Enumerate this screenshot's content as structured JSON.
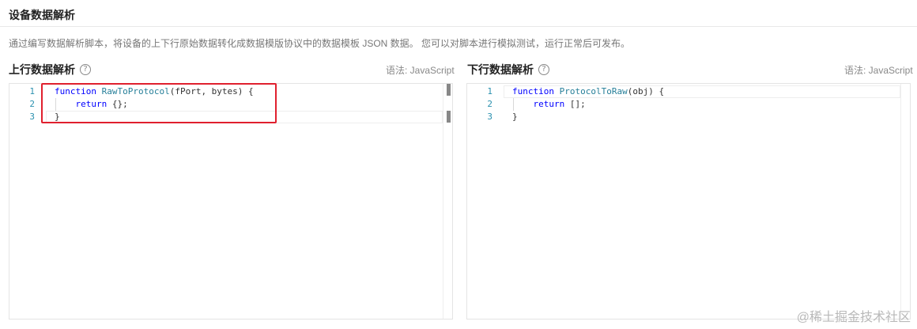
{
  "section": {
    "title": "设备数据解析",
    "description": "通过编写数据解析脚本，将设备的上下行原始数据转化成数据模版协议中的数据模板 JSON 数据。 您可以对脚本进行模拟测试，运行正常后可发布。"
  },
  "uplink": {
    "title": "上行数据解析",
    "help_icon": "?",
    "syntax": "语法: JavaScript",
    "line_numbers": [
      "1",
      "2",
      "3"
    ],
    "code": {
      "line1_kw": "function",
      "line1_fn": "RawToProtocol",
      "line1_rest": "(fPort, bytes) {",
      "line2_kw": "return",
      "line2_rest": " {};",
      "line3": "}"
    }
  },
  "downlink": {
    "title": "下行数据解析",
    "help_icon": "?",
    "syntax": "语法: JavaScript",
    "line_numbers": [
      "1",
      "2",
      "3"
    ],
    "code": {
      "line1_kw": "function",
      "line1_fn": "ProtocolToRaw",
      "line1_rest": "(obj) {",
      "line2_kw": "return",
      "line2_rest": " [];",
      "line3": "}"
    }
  },
  "watermark": "@稀土掘金技术社区",
  "colors": {
    "highlight_border": "#e0202e",
    "keyword": "#0000ff",
    "function_name": "#267f99",
    "line_number": "#2b91af"
  }
}
